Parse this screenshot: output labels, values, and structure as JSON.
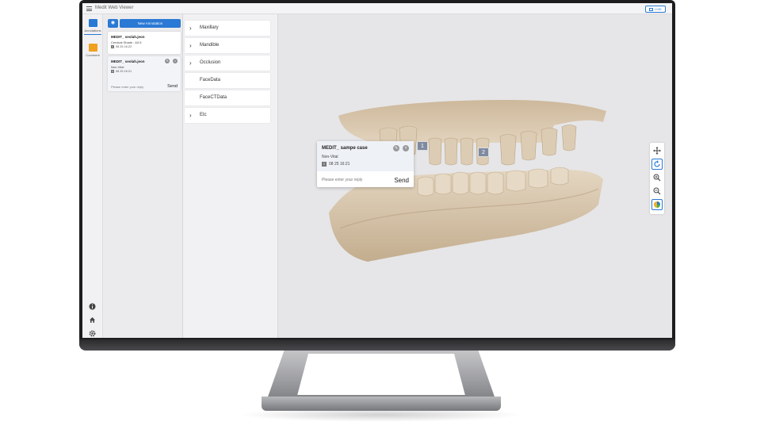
{
  "app": {
    "title": "Medit Web Viewer",
    "live_label": "LIVE"
  },
  "rail": {
    "items": [
      {
        "label": "Annotations",
        "icon": "annotations-icon",
        "color": "#2a79d4"
      },
      {
        "label": "Comment",
        "icon": "comment-icon",
        "color": "#f0a020"
      }
    ],
    "bottom_icons": [
      "info-icon",
      "home-icon",
      "gear-icon"
    ]
  },
  "annotations": {
    "new_button": "New Annotation",
    "cards": [
      {
        "user": "MEDIT_ seolah.jeon",
        "text": "Cervical Shade : A3.5",
        "number": "1",
        "date": "08 25 16:22"
      },
      {
        "user": "MEDIT_ seolah.jeon",
        "text": "Non-Vital",
        "number": "2",
        "date": "08 25 16:21",
        "reply_placeholder": "Please enter your reply",
        "send": "Send"
      }
    ]
  },
  "data_panel": {
    "items": [
      {
        "label": "Maxillary",
        "expandable": true
      },
      {
        "label": "Mandible",
        "expandable": true
      },
      {
        "label": "Occlusion",
        "expandable": true
      },
      {
        "label": "FaceData",
        "expandable": false
      },
      {
        "label": "FaceCTData",
        "expandable": false
      },
      {
        "label": "Etc",
        "expandable": true
      }
    ]
  },
  "popover": {
    "user": "MEDIT_ sampe case",
    "text": "Non-Vital",
    "number": "1",
    "date": "08 25 16:21",
    "reply_placeholder": "Please enter your reply",
    "send": "Send"
  },
  "markers": [
    "1",
    "2"
  ],
  "tools": [
    "move-icon",
    "rotate-icon",
    "zoom-in-icon",
    "zoom-out-icon",
    "color-palette-icon"
  ],
  "colors": {
    "accent": "#2a79d4",
    "model": "#d8c6ad"
  }
}
